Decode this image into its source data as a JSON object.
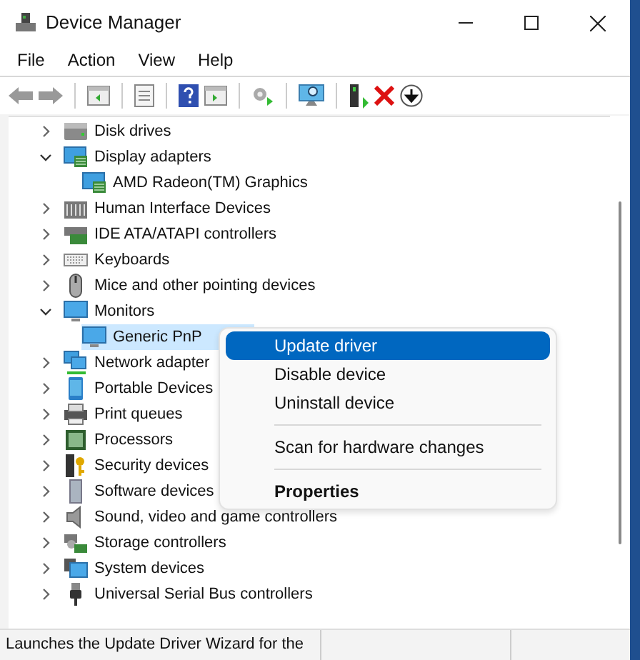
{
  "window": {
    "title": "Device Manager"
  },
  "menu_bar": [
    "File",
    "Action",
    "View",
    "Help"
  ],
  "tree": [
    {
      "label": "Disk drives",
      "kind": "disk",
      "expanded": false,
      "selected": false
    },
    {
      "label": "Display adapters",
      "kind": "display",
      "expanded": true,
      "selected": false,
      "children": [
        {
          "label": "AMD Radeon(TM) Graphics",
          "kind": "display",
          "selected": false
        }
      ]
    },
    {
      "label": "Human Interface Devices",
      "kind": "hid",
      "expanded": false,
      "selected": false
    },
    {
      "label": "IDE ATA/ATAPI controllers",
      "kind": "ide",
      "expanded": false,
      "selected": false
    },
    {
      "label": "Keyboards",
      "kind": "keyboard",
      "expanded": false,
      "selected": false
    },
    {
      "label": "Mice and other pointing devices",
      "kind": "mouse",
      "expanded": false,
      "selected": false
    },
    {
      "label": "Monitors",
      "kind": "monitor",
      "expanded": true,
      "selected": false,
      "children": [
        {
          "label": "Generic PnP",
          "kind": "monitor",
          "selected": true
        }
      ]
    },
    {
      "label": "Network adapter",
      "kind": "network",
      "expanded": false,
      "selected": false
    },
    {
      "label": "Portable Devices",
      "kind": "portable",
      "expanded": false,
      "selected": false
    },
    {
      "label": "Print queues",
      "kind": "printer",
      "expanded": false,
      "selected": false
    },
    {
      "label": "Processors",
      "kind": "cpu",
      "expanded": false,
      "selected": false
    },
    {
      "label": "Security devices",
      "kind": "security",
      "expanded": false,
      "selected": false
    },
    {
      "label": "Software devices",
      "kind": "software",
      "expanded": false,
      "selected": false
    },
    {
      "label": "Sound, video and game controllers",
      "kind": "sound",
      "expanded": false,
      "selected": false
    },
    {
      "label": "Storage controllers",
      "kind": "storage",
      "expanded": false,
      "selected": false
    },
    {
      "label": "System devices",
      "kind": "system",
      "expanded": false,
      "selected": false
    },
    {
      "label": "Universal Serial Bus controllers",
      "kind": "usb",
      "expanded": false,
      "selected": false
    }
  ],
  "context_menu": [
    {
      "kind": "item",
      "label": "Update driver",
      "selected": true
    },
    {
      "kind": "item",
      "label": "Disable device",
      "selected": false
    },
    {
      "kind": "item",
      "label": "Uninstall device",
      "selected": false
    },
    {
      "kind": "separator"
    },
    {
      "kind": "item",
      "label": "Scan for hardware changes",
      "selected": false
    },
    {
      "kind": "separator"
    },
    {
      "kind": "default",
      "label": "Properties",
      "selected": false
    }
  ],
  "status_bar": [
    "Launches the Update Driver Wizard for the"
  ]
}
